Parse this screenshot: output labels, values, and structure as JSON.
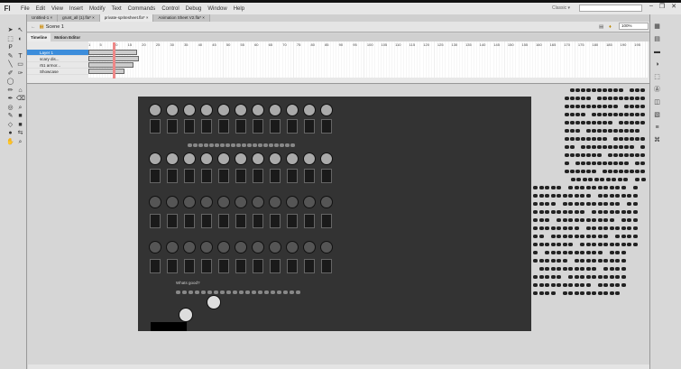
{
  "app": {
    "logo": "Fl",
    "workspace": "Classic ▾",
    "search_placeholder": "",
    "window_buttons": [
      "–",
      "❐",
      "✕"
    ]
  },
  "menu": [
    "File",
    "Edit",
    "View",
    "Insert",
    "Modify",
    "Text",
    "Commands",
    "Control",
    "Debug",
    "Window",
    "Help"
  ],
  "doc_tabs": [
    {
      "label": "Untitled-1 ×",
      "active": false
    },
    {
      "label": "grunt_all (1).fla* ×",
      "active": false
    },
    {
      "label": "private-spritesheet.fla* ×",
      "active": true
    },
    {
      "label": "Animation Sheet V2.fla* ×",
      "active": false
    }
  ],
  "scene": {
    "back": "←",
    "label": "Scene 1"
  },
  "zoom": "100%",
  "timeline": {
    "tabs": [
      "Timeline",
      "Motion Editor"
    ],
    "layers": [
      {
        "name": "Layer 1",
        "selected": true
      },
      {
        "name": "scary dis...",
        "selected": false
      },
      {
        "name": "r51 armor...",
        "selected": false
      },
      {
        "name": "Showcase",
        "selected": false
      }
    ],
    "frame_numbers": [
      "1",
      "5",
      "10",
      "15",
      "20",
      "25",
      "30",
      "35",
      "40",
      "45",
      "50",
      "55",
      "60",
      "65",
      "70",
      "75",
      "80",
      "85",
      "90",
      "95",
      "100",
      "105",
      "110",
      "115",
      "120",
      "125",
      "130",
      "135",
      "140",
      "145",
      "150",
      "155",
      "160",
      "165",
      "170",
      "175",
      "180",
      "185",
      "190",
      "195"
    ],
    "current_frame": 10,
    "controls": "|◀ ◀| ▶ |▶ ▶|",
    "fps": "24.00 fps",
    "time": "0.4 s"
  },
  "stage_text": {
    "caption": "Whats good?"
  },
  "colors": {
    "stage": "#333333",
    "pasteboard": "#d6d6d6",
    "selection": "#3c8ddb",
    "playhead": "#e88888"
  }
}
